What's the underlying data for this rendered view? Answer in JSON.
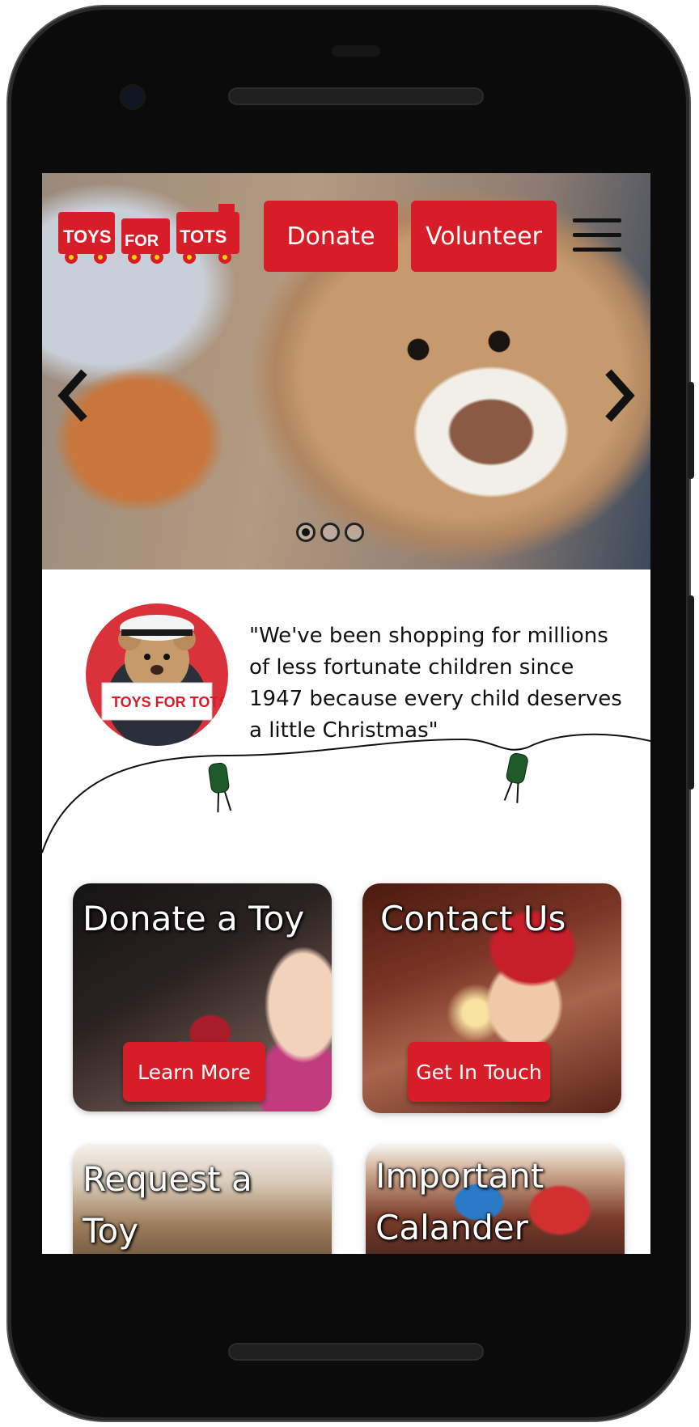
{
  "brand": {
    "logo_text": "TOYS FOR TOTS",
    "accent": "#d71e28"
  },
  "header": {
    "donate_label": "Donate",
    "volunteer_label": "Volunteer",
    "menu_icon": "hamburger-menu-icon"
  },
  "carousel": {
    "prev_icon": "chevron-left-icon",
    "next_icon": "chevron-right-icon",
    "slides": 3,
    "active_slide": 1
  },
  "quote": {
    "text": "\"We've been shopping for millions of less fortunate children since 1947 because every child deserves a little Christmas\""
  },
  "cards": [
    {
      "title": "Donate a Toy",
      "button": "Learn More"
    },
    {
      "title": "Contact Us",
      "button": "Get In Touch"
    },
    {
      "title": "Request a Toy",
      "button": ""
    },
    {
      "title": "Important Calander",
      "button": ""
    }
  ]
}
